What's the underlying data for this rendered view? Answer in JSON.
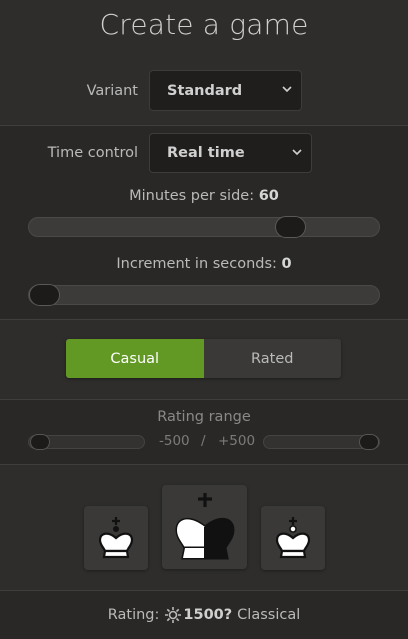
{
  "header": {
    "title": "Create a game"
  },
  "variant": {
    "label": "Variant",
    "value": "Standard"
  },
  "time_control": {
    "label": "Time control",
    "value": "Real time",
    "minutes_label": "Minutes per side:",
    "minutes_value": "60",
    "minutes_slider_fraction": 0.77,
    "increment_label": "Increment in seconds:",
    "increment_value": "0",
    "increment_slider_fraction": 0.0
  },
  "mode": {
    "casual_label": "Casual",
    "rated_label": "Rated",
    "selected": "Casual"
  },
  "rating_range": {
    "title": "Rating range",
    "min": "-500",
    "separator": "/",
    "max": "+500"
  },
  "colors": {
    "black": {
      "icon": "black-king-icon"
    },
    "random": {
      "icon": "random-king-icon"
    },
    "white": {
      "icon": "white-king-icon"
    }
  },
  "rating": {
    "label": "Rating:",
    "icon": "classical-icon",
    "value": "1500?",
    "perf": "Classical"
  },
  "theme": {
    "accent": "#629924",
    "background": "#2e2d2b"
  }
}
